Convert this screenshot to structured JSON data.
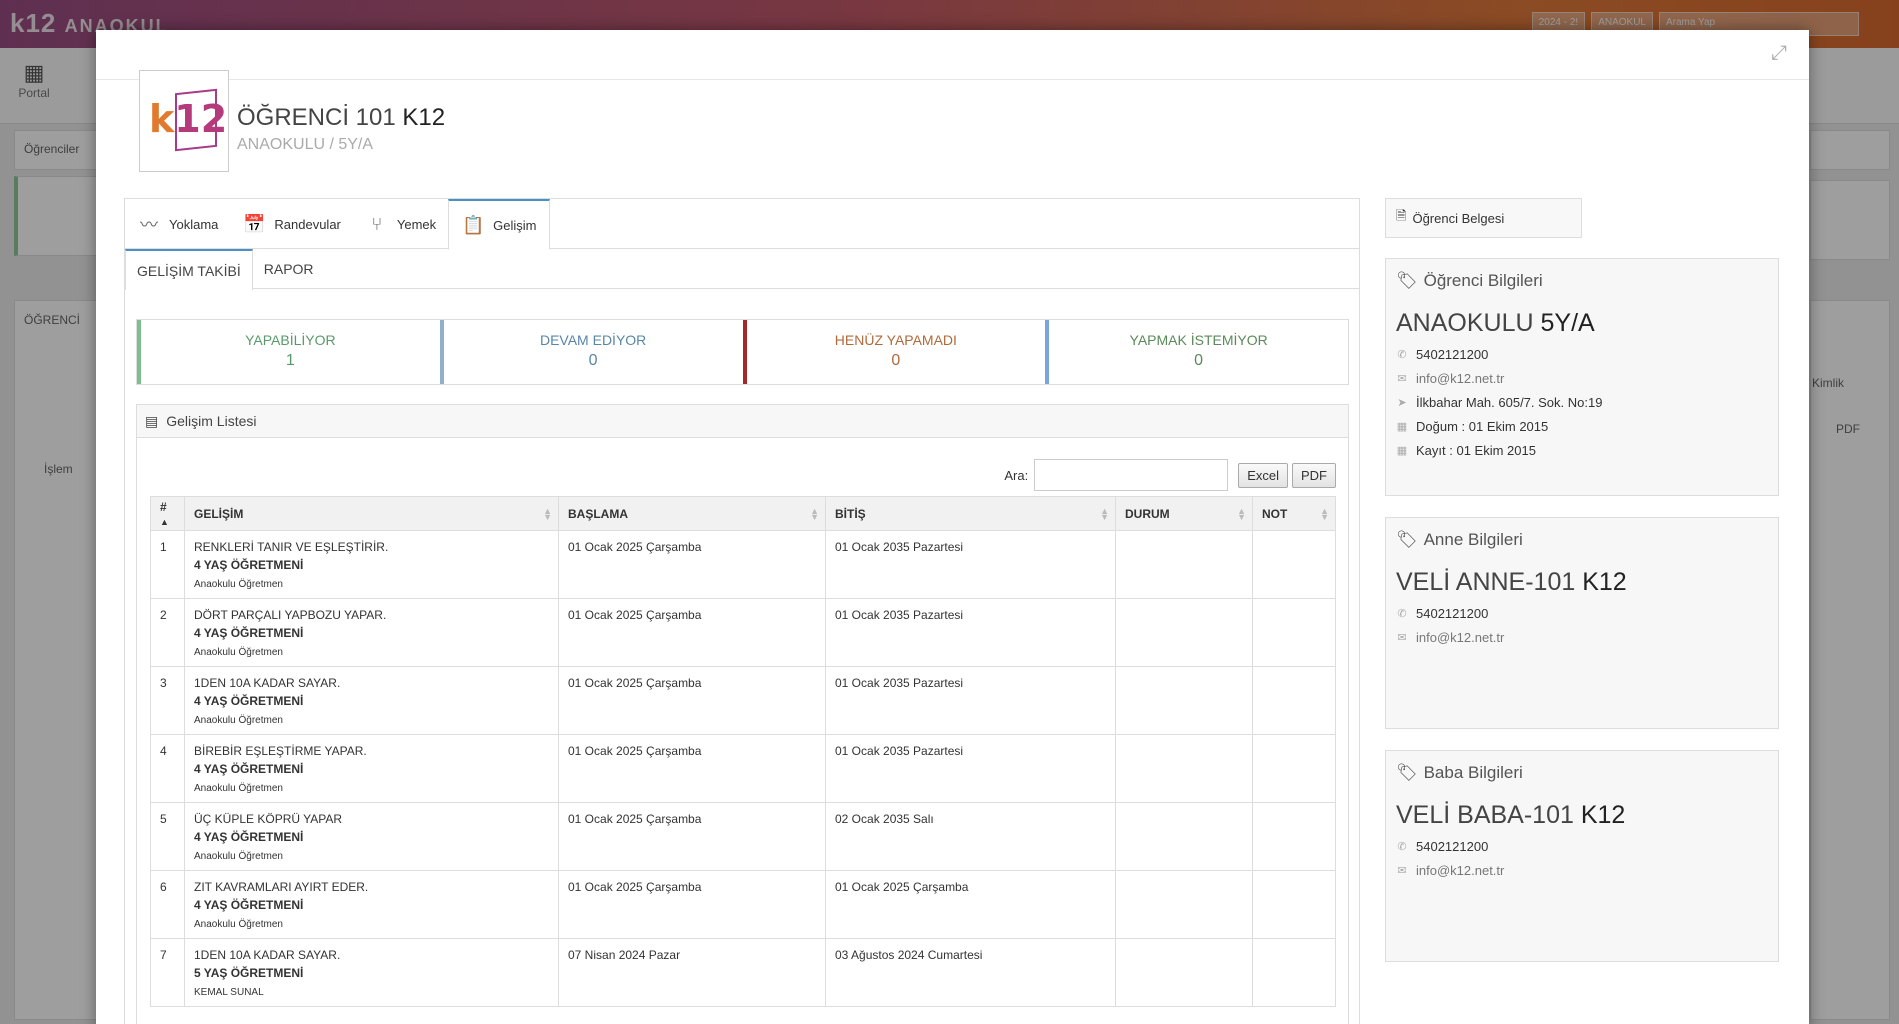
{
  "app": {
    "brand": "k12",
    "brand_suffix": "ANAOKUL",
    "portal_label": "Portal",
    "top_year": "2024 - 2!",
    "top_school": "ANAOKUL",
    "top_search_placeholder": "Arama Yap",
    "bg_students_label": "Öğrenciler",
    "bg_students_label2": "ÖĞRENCİ",
    "bg_process_label": "İşlem",
    "bg_pdf": "PDF",
    "bg_kimlik": "Kimlik"
  },
  "student": {
    "name_light": "ÖĞRENCİ 101",
    "name_bold": "K12",
    "subtitle": "ANAOKULU / 5Y/A",
    "logo_k": "k",
    "logo_12": "12"
  },
  "tabs": [
    {
      "label": "Yoklama",
      "icon": "rss-icon"
    },
    {
      "label": "Randevular",
      "icon": "calendar-check-icon"
    },
    {
      "label": "Yemek",
      "icon": "fork-icon"
    },
    {
      "label": "Gelişim",
      "icon": "clipboard-icon"
    }
  ],
  "subtabs": [
    "GELİŞİM TAKİBİ",
    "RAPOR"
  ],
  "stats": [
    {
      "label": "YAPABİLİYOR",
      "value": "1",
      "color": "#7fbf8f",
      "text_color": "#5a9a6a"
    },
    {
      "label": "DEVAM EDİYOR",
      "value": "0",
      "color": "#8fb0c8",
      "text_color": "#5a86a6"
    },
    {
      "label": "HENÜZ YAPAMADI",
      "value": "0",
      "color": "#a32a2a",
      "text_color": "#b06a3a"
    },
    {
      "label": "YAPMAK İSTEMİYOR",
      "value": "0",
      "color": "#7aa6e0",
      "text_color": "#5a8a5a"
    }
  ],
  "list": {
    "title": "Gelişim Listesi",
    "search_label": "Ara:",
    "search_value": "",
    "excel_label": "Excel",
    "pdf_label": "PDF",
    "columns": [
      "#",
      "GELİŞİM",
      "BAŞLAMA",
      "BİTİŞ",
      "DURUM",
      "NOT"
    ],
    "rows": [
      {
        "no": "1",
        "title": "RENKLERİ TANIR VE EŞLEŞTİRİR.",
        "group": "4 YAŞ ÖĞRETMENİ",
        "teacher": "Anaokulu Öğretmen",
        "start": "01 Ocak 2025 Çarşamba",
        "end": "01 Ocak 2035 Pazartesi",
        "status": "",
        "note": ""
      },
      {
        "no": "2",
        "title": "DÖRT PARÇALI YAPBOZU YAPAR.",
        "group": "4 YAŞ ÖĞRETMENİ",
        "teacher": "Anaokulu Öğretmen",
        "start": "01 Ocak 2025 Çarşamba",
        "end": "01 Ocak 2035 Pazartesi",
        "status": "",
        "note": ""
      },
      {
        "no": "3",
        "title": "1DEN 10A KADAR SAYAR.",
        "group": "4 YAŞ ÖĞRETMENİ",
        "teacher": "Anaokulu Öğretmen",
        "start": "01 Ocak 2025 Çarşamba",
        "end": "01 Ocak 2035 Pazartesi",
        "status": "",
        "note": ""
      },
      {
        "no": "4",
        "title": "BİREBİR EŞLEŞTİRME YAPAR.",
        "group": "4 YAŞ ÖĞRETMENİ",
        "teacher": "Anaokulu Öğretmen",
        "start": "01 Ocak 2025 Çarşamba",
        "end": "01 Ocak 2035 Pazartesi",
        "status": "",
        "note": ""
      },
      {
        "no": "5",
        "title": "ÜÇ KÜPLE KÖPRÜ YAPAR",
        "group": "4 YAŞ ÖĞRETMENİ",
        "teacher": "Anaokulu Öğretmen",
        "start": "01 Ocak 2025 Çarşamba",
        "end": "02 Ocak 2035 Salı",
        "status": "",
        "note": ""
      },
      {
        "no": "6",
        "title": "ZIT KAVRAMLARI AYIRT EDER.",
        "group": "4 YAŞ ÖĞRETMENİ",
        "teacher": "Anaokulu Öğretmen",
        "start": "01 Ocak 2025 Çarşamba",
        "end": "01 Ocak 2025 Çarşamba",
        "status": "",
        "note": ""
      },
      {
        "no": "7",
        "title": "1DEN 10A KADAR SAYAR.",
        "group": "5 YAŞ ÖĞRETMENİ",
        "teacher": "KEMAL SUNAL",
        "start": "07 Nisan 2024 Pazar",
        "end": "03 Ağustos 2024 Cumartesi",
        "status": "",
        "note": ""
      }
    ]
  },
  "right": {
    "doc_button": "Öğrenci Belgesi",
    "student_info": {
      "header": "Öğrenci Bilgileri",
      "name_light": "ANAOKULU",
      "name_bold": "5Y/A",
      "phone": "5402121200",
      "email": "info@k12.net.tr",
      "address": "İlkbahar Mah. 605/7. Sok. No:19",
      "birth": "Doğum : 01 Ekim 2015",
      "register": "Kayıt : 01 Ekim 2015"
    },
    "mother_info": {
      "header": "Anne Bilgileri",
      "name_light": "VELİ ANNE-101",
      "name_bold": "K12",
      "phone": "5402121200",
      "email": "info@k12.net.tr"
    },
    "father_info": {
      "header": "Baba Bilgileri",
      "name_light": "VELİ BABA-101",
      "name_bold": "K12",
      "phone": "5402121200",
      "email": "info@k12.net.tr"
    }
  }
}
